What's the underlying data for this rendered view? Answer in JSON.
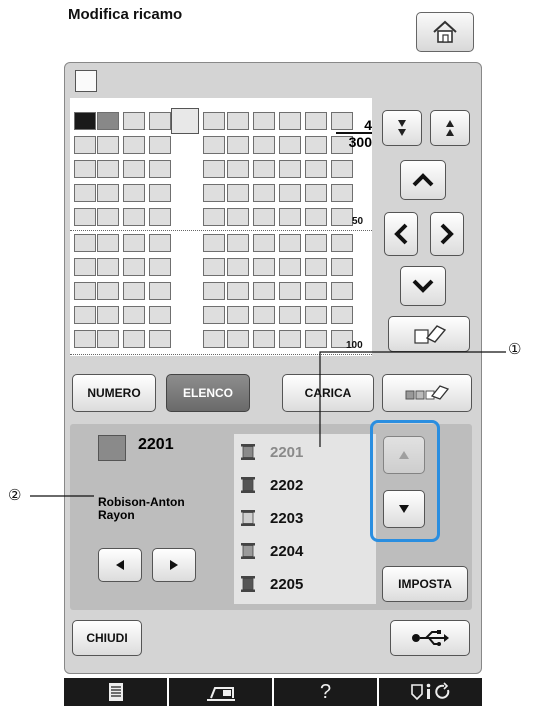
{
  "header": {
    "title": "Modifica ricamo",
    "home_icon": "home-icon"
  },
  "palette": {
    "page_fraction_num": "4",
    "page_fraction_den": "300",
    "marker_50": "50",
    "marker_100": "100",
    "cursor_color": "#1a1a1a",
    "second_color": "#888888"
  },
  "buttons": {
    "numero": "NUMERO",
    "elenco": "ELENCO",
    "carica": "CARICA",
    "imposta": "IMPOSTA",
    "chiudi": "CHIUDI"
  },
  "selected": {
    "code": "2201",
    "brand_line1": "Robison-Anton",
    "brand_line2": "Rayon"
  },
  "thread_list": [
    {
      "code": "2201",
      "color": "#8a8a8a",
      "active": true
    },
    {
      "code": "2202",
      "color": "#555555",
      "active": false
    },
    {
      "code": "2203",
      "color": "#cfcfcf",
      "active": false
    },
    {
      "code": "2204",
      "color": "#9a9a9a",
      "active": false
    },
    {
      "code": "2205",
      "color": "#555555",
      "active": false
    }
  ],
  "callouts": {
    "c1": "①",
    "c2": "②"
  },
  "bottom_bar": {
    "help": "?"
  },
  "colors": {
    "highlight": "#2a8ee0"
  }
}
